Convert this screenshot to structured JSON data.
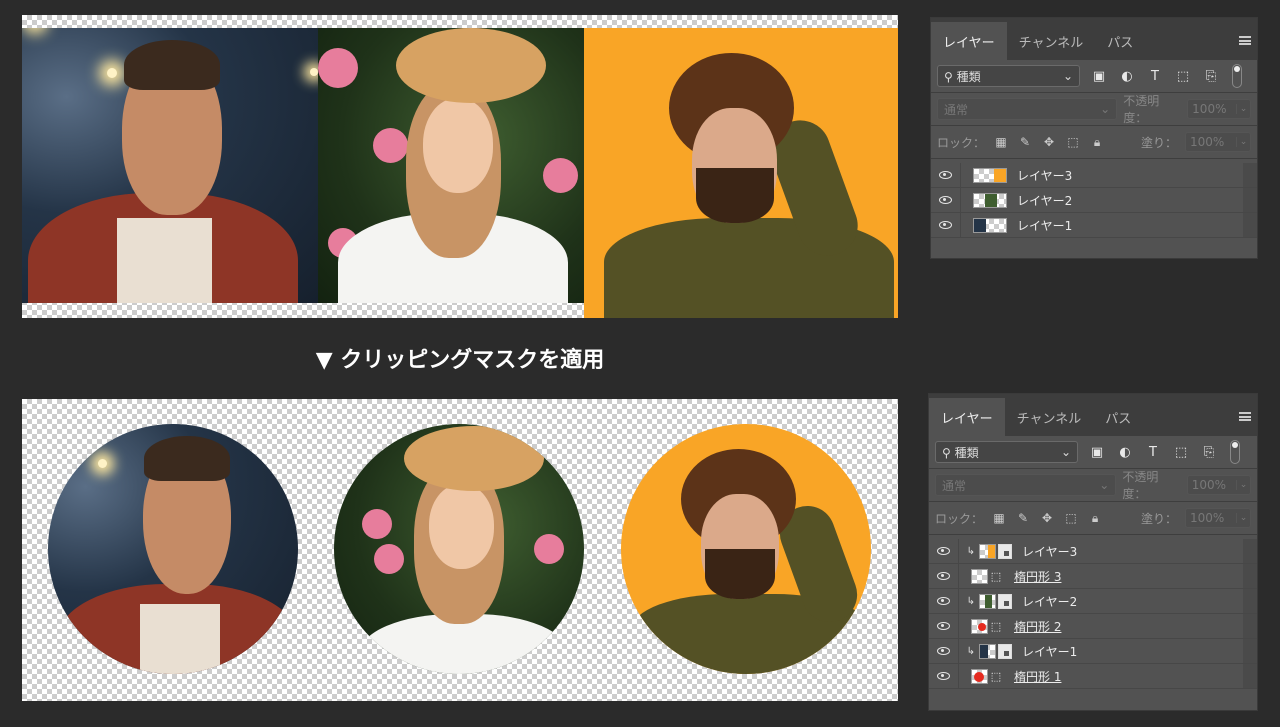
{
  "heading": "▼ クリッピングマスクを適用",
  "panel_top": {
    "tabs": [
      "レイヤー",
      "チャンネル",
      "パス"
    ],
    "filter_label": "種類",
    "blend_mode": "通常",
    "opacity_label": "不透明度：",
    "opacity_value": "100%",
    "lock_label": "ロック：",
    "fill_label": "塗り：",
    "fill_value": "100%",
    "layers": [
      "レイヤー3",
      "レイヤー2",
      "レイヤー1"
    ]
  },
  "panel_bottom": {
    "tabs": [
      "レイヤー",
      "チャンネル",
      "パス"
    ],
    "filter_label": "種類",
    "blend_mode": "通常",
    "opacity_label": "不透明度：",
    "opacity_value": "100%",
    "lock_label": "ロック：",
    "fill_label": "塗り：",
    "fill_value": "100%",
    "layers": [
      "レイヤー3",
      "楕円形 3",
      "レイヤー2",
      "楕円形 2",
      "レイヤー1",
      "楕円形 1"
    ]
  },
  "colors": {
    "background": "#2b2b2b",
    "panel": "#525252",
    "orange_photo": "#f9a526",
    "ellipse_red": "#e52a1f"
  },
  "icons": [
    "search-icon",
    "image-filter-icon",
    "adjustment-filter-icon",
    "type-filter-icon",
    "shape-filter-icon",
    "smart-object-filter-icon",
    "eye-icon",
    "lock-pixels-icon",
    "brush-icon",
    "move-icon",
    "artboard-icon",
    "lock-icon",
    "panel-menu-icon",
    "clipping-arrow-icon"
  ]
}
